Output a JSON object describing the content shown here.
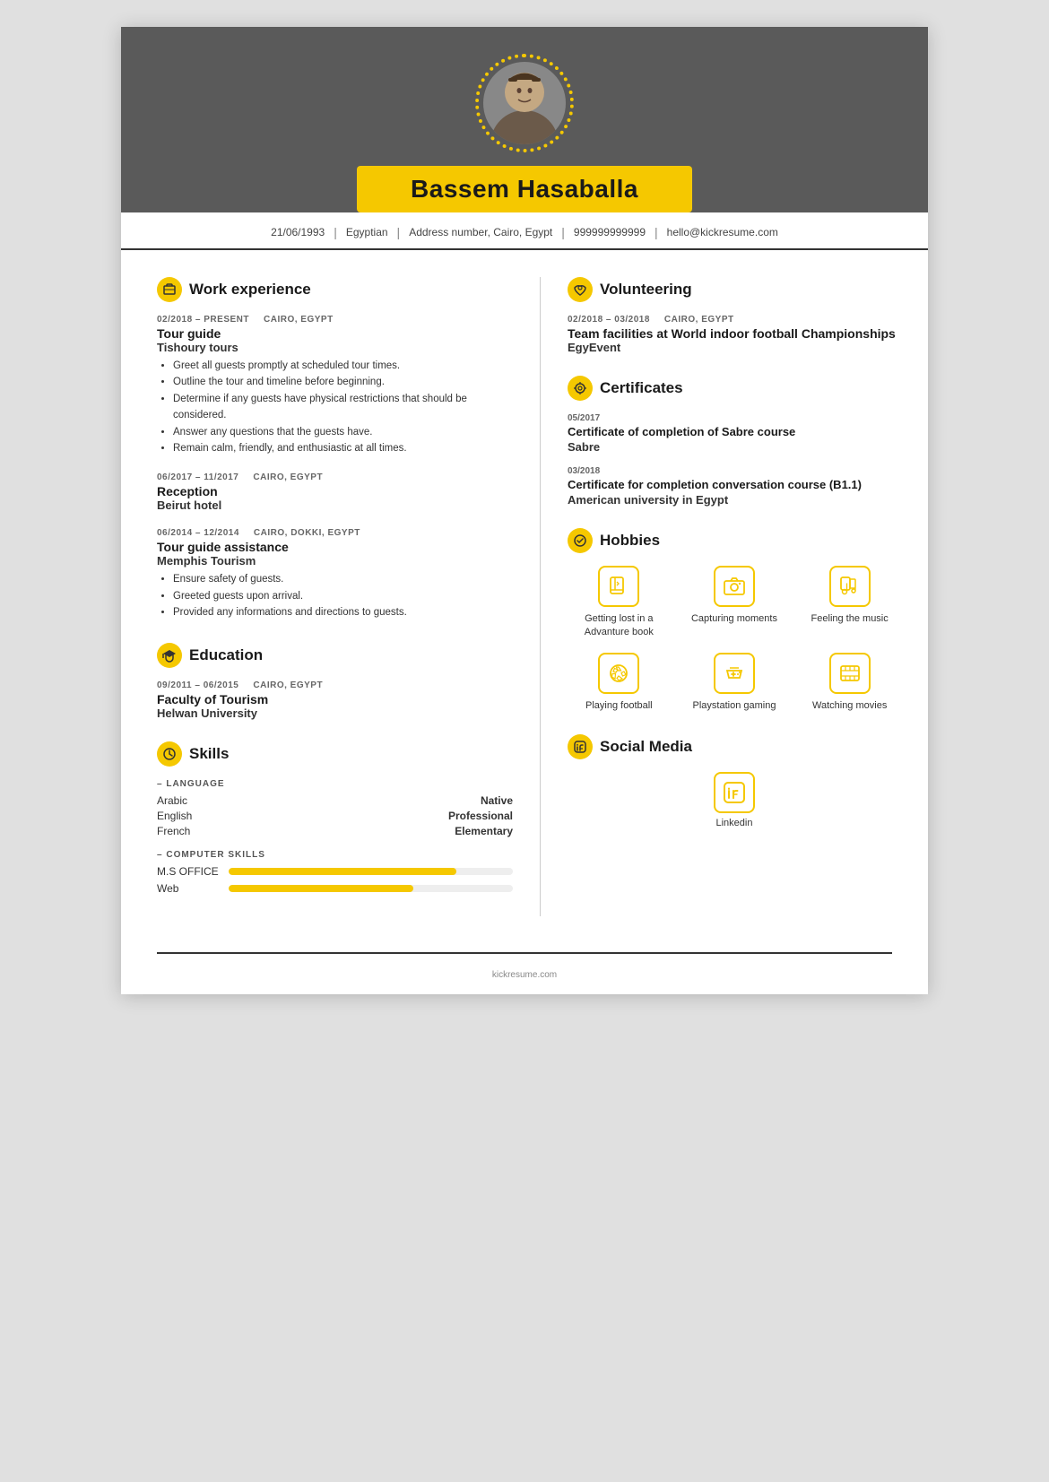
{
  "header": {
    "name": "Bassem Hasaballa"
  },
  "contact": {
    "dob": "21/06/1993",
    "nationality": "Egyptian",
    "address": "Address number, Cairo, Egypt",
    "phone": "999999999999",
    "email": "hello@kickresume.com"
  },
  "work": {
    "section_title": "Work experience",
    "entries": [
      {
        "period": "02/2018 – PRESENT",
        "location": "CAIRO, EGYPT",
        "title": "Tour guide",
        "company": "Tishoury tours",
        "bullets": [
          "Greet all guests promptly at scheduled tour times.",
          "Outline the tour and timeline before beginning.",
          "Determine if any guests have physical restrictions that should be considered.",
          "Answer any questions that the guests have.",
          "Remain calm, friendly, and enthusiastic at all times."
        ]
      },
      {
        "period": "06/2017 – 11/2017",
        "location": "CAIRO, EGYPT",
        "title": "Reception",
        "company": "Beirut hotel",
        "bullets": []
      },
      {
        "period": "06/2014 – 12/2014",
        "location": "CAIRO, DOKKI, EGYPT",
        "title": "Tour guide assistance",
        "company": "Memphis Tourism",
        "bullets": [
          "Ensure safety of guests.",
          "Greeted guests upon arrival.",
          "Provided any informations and directions to guests."
        ]
      }
    ]
  },
  "education": {
    "section_title": "Education",
    "entries": [
      {
        "period": "09/2011 – 06/2015",
        "location": "CAIRO, EGYPT",
        "title": "Faculty of Tourism",
        "company": "Helwan University",
        "bullets": []
      }
    ]
  },
  "skills": {
    "section_title": "Skills",
    "languages": {
      "label": "LANGUAGE",
      "items": [
        {
          "name": "Arabic",
          "level": "Native"
        },
        {
          "name": "English",
          "level": "Professional"
        },
        {
          "name": "French",
          "level": "Elementary"
        }
      ]
    },
    "computer": {
      "label": "COMPUTER SKILLS",
      "items": [
        {
          "name": "M.S OFFICE",
          "pct": 80
        },
        {
          "name": "Web",
          "pct": 65
        }
      ]
    }
  },
  "volunteering": {
    "section_title": "Volunteering",
    "entries": [
      {
        "period": "02/2018 – 03/2018",
        "location": "CAIRO, EGYPT",
        "title": "Team facilities at World indoor football Championships",
        "company": "EgyEvent"
      }
    ]
  },
  "certificates": {
    "section_title": "Certificates",
    "entries": [
      {
        "date": "05/2017",
        "title": "Certificate of completion of Sabre course",
        "org": "Sabre"
      },
      {
        "date": "03/2018",
        "title": "Certificate for completion conversation course (B1.1)",
        "org": "American university in Egypt"
      }
    ]
  },
  "hobbies": {
    "section_title": "Hobbies",
    "items": [
      {
        "label": "Getting lost in a Advanture book",
        "icon": "book"
      },
      {
        "label": "Capturing moments",
        "icon": "camera"
      },
      {
        "label": "Feeling the music",
        "icon": "music"
      },
      {
        "label": "Playing football",
        "icon": "football"
      },
      {
        "label": "Playstation gaming",
        "icon": "gaming"
      },
      {
        "label": "Watching movies",
        "icon": "movies"
      }
    ]
  },
  "social": {
    "section_title": "Social Media",
    "items": [
      {
        "label": "Linkedin",
        "icon": "linkedin"
      }
    ]
  }
}
